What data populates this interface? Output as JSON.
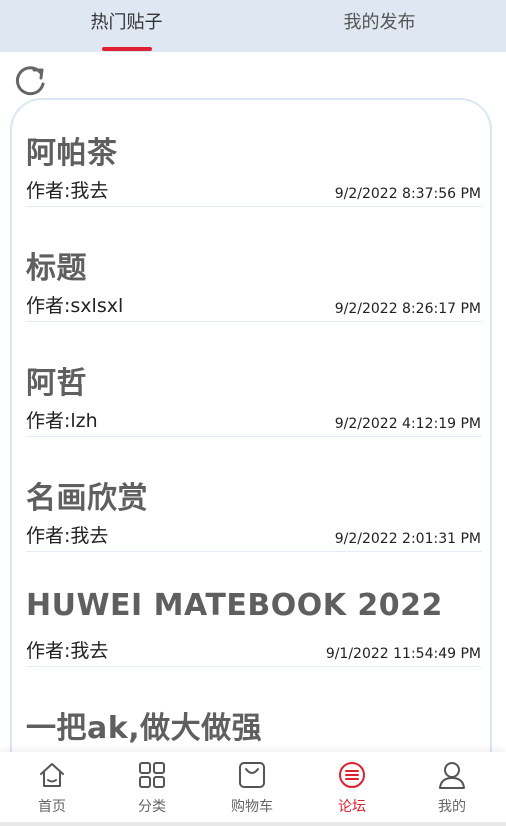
{
  "tabs": [
    {
      "label": "热门贴子",
      "active": true
    },
    {
      "label": "我的发布",
      "active": false
    }
  ],
  "colors": {
    "accent": "#e02030",
    "tab_bg": "#dfe8f2",
    "card_border": "#d9e6f4",
    "title": "#5f5f5f"
  },
  "refresh_icon": "refresh-icon",
  "posts": [
    {
      "title": "阿帕茶",
      "author_prefix": "作者:",
      "author": "我去",
      "time": "9/2/2022 8:37:56 PM"
    },
    {
      "title": "标题",
      "author_prefix": "作者:",
      "author": "sxlsxl",
      "time": "9/2/2022 8:26:17 PM"
    },
    {
      "title": "阿哲",
      "author_prefix": "作者:",
      "author": "lzh",
      "time": "9/2/2022 4:12:19 PM"
    },
    {
      "title": "名画欣赏",
      "author_prefix": "作者:",
      "author": "我去",
      "time": "9/2/2022 2:01:31 PM"
    },
    {
      "title": "HUWEI MATEBOOK 2022",
      "author_prefix": "作者:",
      "author": "我去",
      "time": "9/1/2022 11:54:49 PM"
    },
    {
      "title": "一把ak,做大做强",
      "author_prefix": "",
      "author": "",
      "time": ""
    }
  ],
  "nav": [
    {
      "label": "首页",
      "icon": "home-icon",
      "active": false
    },
    {
      "label": "分类",
      "icon": "grid-icon",
      "active": false
    },
    {
      "label": "购物车",
      "icon": "shopping-bag-icon",
      "active": false
    },
    {
      "label": "论坛",
      "icon": "forum-icon",
      "active": true
    },
    {
      "label": "我的",
      "icon": "user-icon",
      "active": false
    }
  ]
}
